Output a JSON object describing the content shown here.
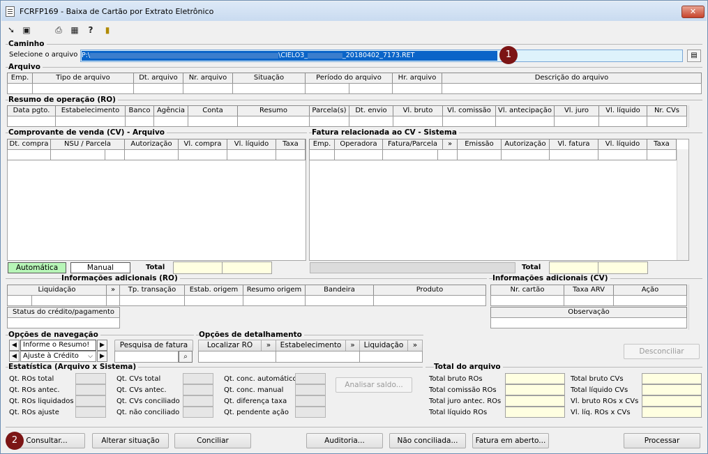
{
  "window": {
    "title": "FCRFP169 - Baixa de Cartão por Extrato Eletrônico",
    "close_label": "✕"
  },
  "toolbar": {
    "icons": [
      "arrow-in-icon",
      "layers-icon",
      "printer-icon",
      "grid-icon",
      "help-icon",
      "exit-door-icon"
    ]
  },
  "caminho": {
    "group_label": "Caminho",
    "file_label": "Selecione o arquivo",
    "path_start": "P:\\",
    "path_mid": "\\CIELO3_",
    "path_end": "_20180402_7173.RET",
    "badge": "1"
  },
  "arquivo": {
    "group_label": "Arquivo",
    "columns": [
      "Emp.",
      "Tipo de arquivo",
      "Dt. arquivo",
      "Nr. arquivo",
      "Situação",
      "Período do arquivo",
      "Hr. arquivo",
      "Descrição do arquivo"
    ]
  },
  "ro": {
    "group_label": "Resumo de operação (RO)",
    "columns": [
      "Data pgto.",
      "Estabelecimento",
      "Banco",
      "Agência",
      "Conta",
      "Resumo",
      "Parcela(s)",
      "Dt. envio",
      "Vl. bruto",
      "Vl. comissão",
      "Vl. antecipação",
      "Vl. juro",
      "Vl. líquido",
      "Nr. CVs"
    ]
  },
  "cv": {
    "group_label": "Comprovante de venda (CV) - Arquivo",
    "columns": [
      "Dt. compra",
      "NSU / Parcela",
      "Autorização",
      "Vl. compra",
      "Vl. líquido",
      "Taxa"
    ],
    "btn_automatica": "Automática",
    "btn_manual": "Manual",
    "total_label": "Total"
  },
  "fatura": {
    "group_label": "Fatura relacionada ao CV - Sistema",
    "columns": [
      "Emp.",
      "Operadora",
      "Fatura/Parcela",
      "»",
      "Emissão",
      "Autorização",
      "Vl. fatura",
      "Vl. líquido",
      "Taxa"
    ],
    "total_label": "Total"
  },
  "info_ro": {
    "group_label": "Informações adicionais (RO)",
    "columns": [
      "Liquidação",
      "»",
      "Tp. transação",
      "Estab. origem",
      "Resumo origem",
      "Bandeira",
      "Produto"
    ],
    "status_label": "Status do crédito/pagamento"
  },
  "info_cv": {
    "group_label": "Informações adicionais (CV)",
    "columns": [
      "Nr. cartão",
      "Taxa ARV",
      "Ação"
    ],
    "obs_label": "Observação"
  },
  "nav": {
    "group_label": "Opções de navegação",
    "opt1": "Informe o Resumo!",
    "opt2": "Ajuste à Crédito",
    "search_button": "Pesquisa de fatura"
  },
  "detalhe": {
    "group_label": "Opções de detalhamento",
    "buttons": [
      "Localizar RO",
      "»",
      "Estabelecimento",
      "»",
      "Liquidação",
      "»"
    ]
  },
  "desconciliar": "Desconciliar",
  "estatistica": {
    "group_label": "Estatística (Arquivo x Sistema)",
    "col1": [
      "Qt. ROs total",
      "Qt. ROs antec.",
      "Qt. ROs liquidados",
      "Qt. ROs ajuste"
    ],
    "col2": [
      "Qt. CVs total",
      "Qt. CVs antec.",
      "Qt. CVs conciliado",
      "Qt. não conciliado"
    ],
    "col3": [
      "Qt. conc. automático",
      "Qt. conc. manual",
      "Qt. diferença taxa",
      "Qt. pendente ação"
    ],
    "analisar": "Analisar saldo..."
  },
  "total_arquivo": {
    "group_label": "Total do arquivo",
    "col1": [
      "Total bruto ROs",
      "Total comissão ROs",
      "Total juro antec. ROs",
      "Total líquido ROs"
    ],
    "col2": [
      "Total bruto CVs",
      "Total líquido CVs",
      "Vl. bruto ROs x CVs",
      "Vl. líq. ROs x CVs"
    ]
  },
  "bottom": {
    "badge": "2",
    "buttons": [
      "Consultar...",
      "Alterar situação",
      "Conciliar",
      "Auditoria...",
      "Não conciliada...",
      "Fatura em aberto...",
      "Processar"
    ]
  },
  "colors": {
    "badge": "#7c1515",
    "yellow_field": "#ffffe1",
    "automatica": "#b7f5b7",
    "selection": "#0a64c8"
  }
}
